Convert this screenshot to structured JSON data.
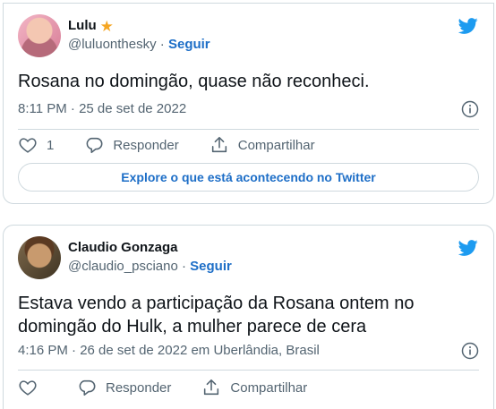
{
  "tweets": [
    {
      "display_name": "Lulu",
      "handle": "@luluonthesky",
      "separator": "·",
      "follow_label": "Seguir",
      "text": "Rosana no domingão, quase não reconheci.",
      "timestamp": "8:11 PM · 25 de set de 2022",
      "like_count": "1",
      "reply_label": "Responder",
      "share_label": "Compartilhar",
      "explore_label": "Explore o que está acontecendo no Twitter",
      "badge_icon": "star-icon"
    },
    {
      "display_name": "Claudio Gonzaga",
      "handle": "@claudio_psciano",
      "separator": "·",
      "follow_label": "Seguir",
      "text": "Estava vendo a participação da Rosana ontem no domingão do Hulk, a mulher parece de cera",
      "timestamp": "4:16 PM · 26 de set de 2022 em Uberlândia, Brasil",
      "like_count": "",
      "reply_label": "Responder",
      "share_label": "Compartilhar"
    }
  ],
  "colors": {
    "twitter_blue": "#1d9bf0",
    "link_blue": "#1d6ec7",
    "secondary_text": "#536471",
    "border": "#cfd9de"
  }
}
